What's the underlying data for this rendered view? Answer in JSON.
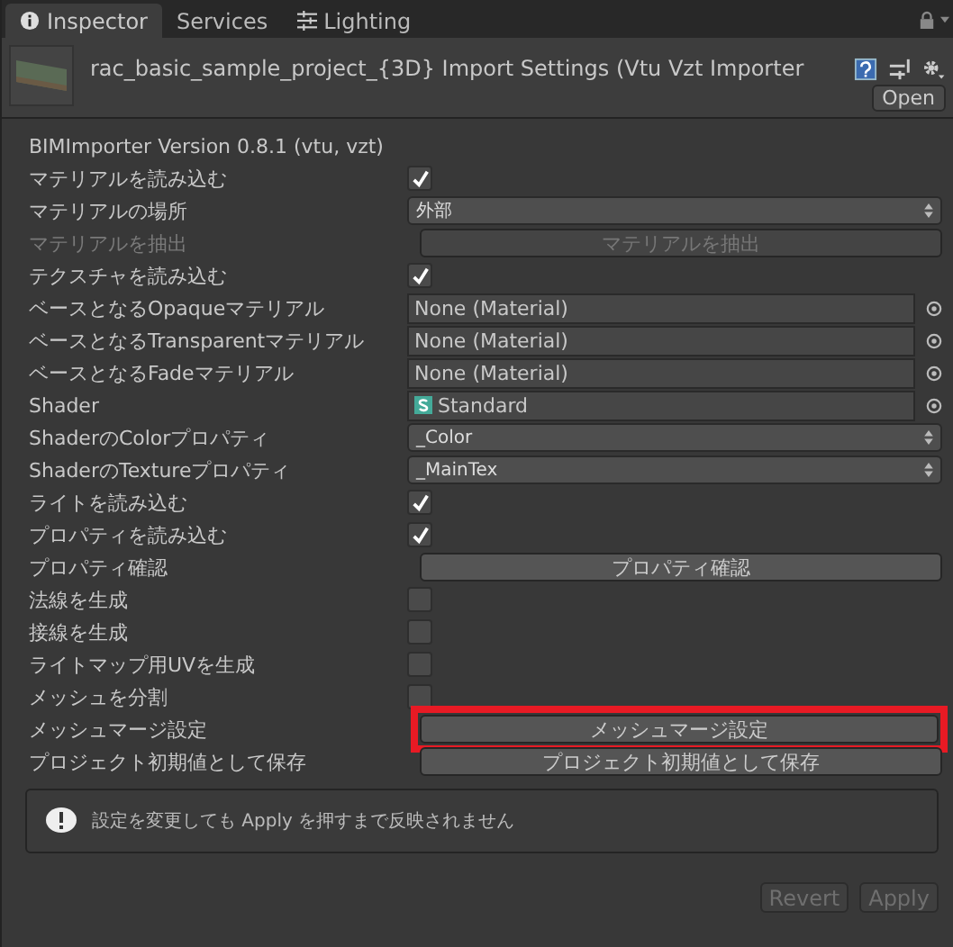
{
  "tabs": [
    {
      "label": "Inspector",
      "selected": true
    },
    {
      "label": "Services",
      "selected": false
    },
    {
      "label": "Lighting",
      "selected": false
    }
  ],
  "header": {
    "title": "rac_basic_sample_project_{3D} Import Settings (Vtu Vzt Importer",
    "open_button": "Open"
  },
  "version": "BIMImporter Version 0.8.1 (vtu, vzt)",
  "rows": [
    {
      "kind": "checkbox",
      "label": "マテリアルを読み込む",
      "checked": true
    },
    {
      "kind": "dropdown",
      "label": "マテリアルの場所",
      "value": "外部"
    },
    {
      "kind": "button",
      "label": "マテリアルを抽出",
      "button": "マテリアルを抽出",
      "disabled": true,
      "highlighted": false
    },
    {
      "kind": "checkbox",
      "label": "テクスチャを読み込む",
      "checked": true
    },
    {
      "kind": "object",
      "label": "ベースとなるOpaqueマテリアル",
      "value": "None (Material)"
    },
    {
      "kind": "object",
      "label": "ベースとなるTransparentマテリアル",
      "value": "None (Material)"
    },
    {
      "kind": "object",
      "label": "ベースとなるFadeマテリアル",
      "value": "None (Material)"
    },
    {
      "kind": "shader",
      "label": "Shader",
      "value": "Standard"
    },
    {
      "kind": "dropdown",
      "label": "ShaderのColorプロパティ",
      "value": "_Color"
    },
    {
      "kind": "dropdown",
      "label": "ShaderのTextureプロパティ",
      "value": "_MainTex"
    },
    {
      "kind": "checkbox",
      "label": "ライトを読み込む",
      "checked": true
    },
    {
      "kind": "checkbox",
      "label": "プロパティを読み込む",
      "checked": true
    },
    {
      "kind": "button",
      "label": "プロパティ確認",
      "button": "プロパティ確認",
      "disabled": false,
      "highlighted": false
    },
    {
      "kind": "checkbox",
      "label": "法線を生成",
      "checked": false
    },
    {
      "kind": "checkbox",
      "label": "接線を生成",
      "checked": false
    },
    {
      "kind": "checkbox",
      "label": "ライトマップ用UVを生成",
      "checked": false
    },
    {
      "kind": "checkbox",
      "label": "メッシュを分割",
      "checked": false
    },
    {
      "kind": "button",
      "label": "メッシュマージ設定",
      "button": "メッシュマージ設定",
      "disabled": false,
      "highlighted": true
    },
    {
      "kind": "button",
      "label": "プロジェクト初期値として保存",
      "button": "プロジェクト初期値として保存",
      "disabled": false,
      "highlighted": false
    }
  ],
  "notice": "設定を変更しても Apply を押すまで反映されません",
  "footer_buttons": [
    {
      "label": "Revert",
      "disabled": true
    },
    {
      "label": "Apply",
      "disabled": true
    }
  ]
}
